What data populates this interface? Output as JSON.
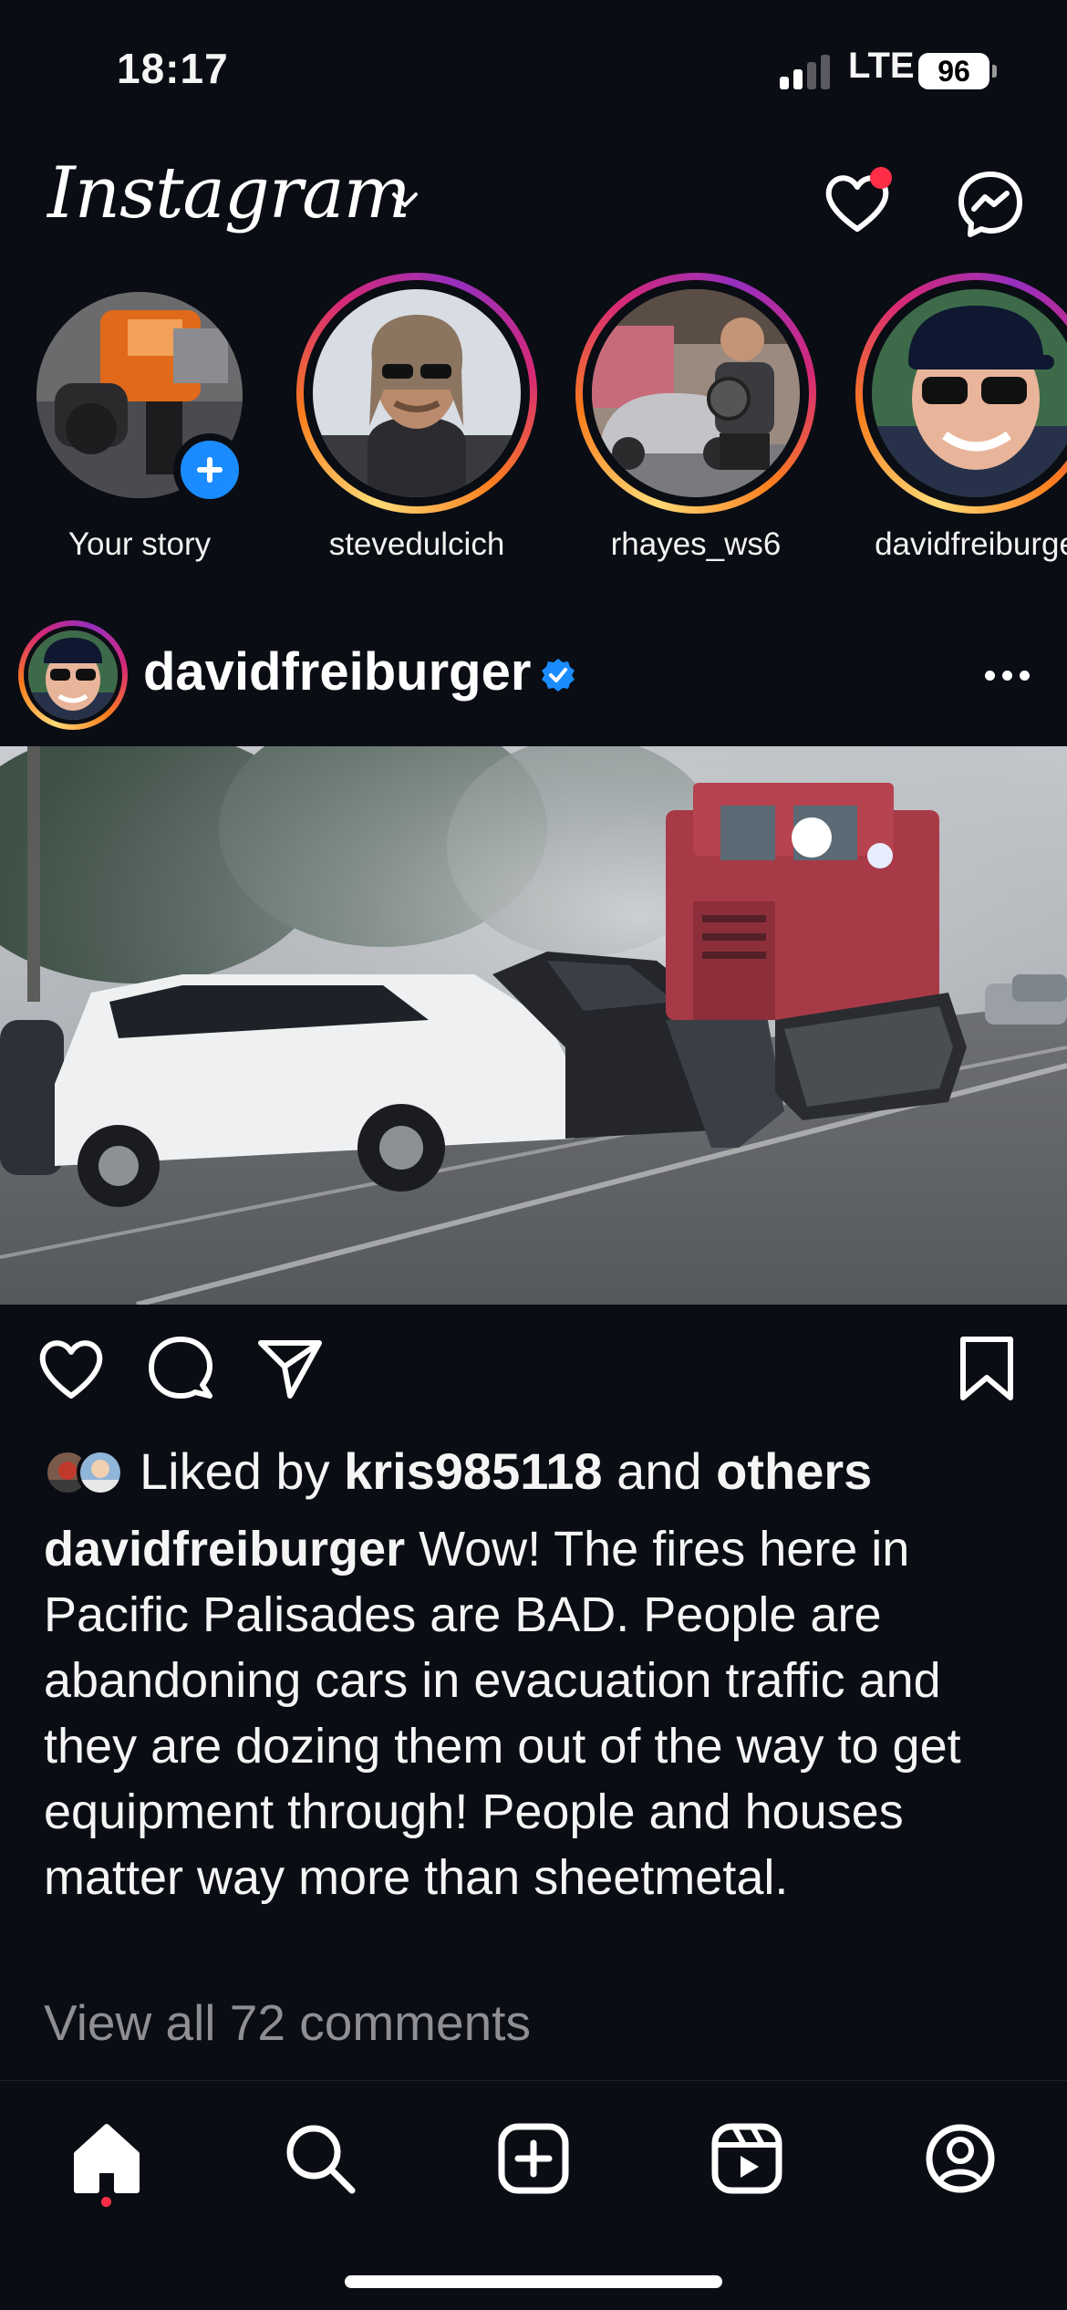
{
  "status_bar": {
    "time": "18:17",
    "network": "LTE",
    "battery": "96"
  },
  "header": {
    "logo": "Instagram",
    "icons": [
      "chevron-down-icon",
      "heart-icon",
      "messenger-icon"
    ],
    "notification_color": "#ff2e47"
  },
  "stories": [
    {
      "label": "Your story"
    },
    {
      "label": "stevedulcich"
    },
    {
      "label": "rhayes_ws6"
    },
    {
      "label": "davidfreiburge"
    }
  ],
  "post": {
    "username": "davidfreiburger",
    "verified_color": "#1a8cff",
    "likes": {
      "prefix": "Liked by ",
      "user": "kris985118",
      "middle": " and ",
      "others": "others"
    },
    "caption_user": "davidfreiburger",
    "caption_text": " Wow! The fires here in Pacific Palisades are BAD. People are abandoning cars in evacuation traffic and they are dozing them out of the way to get equipment through! People and houses matter way more than sheetmetal.",
    "view_comments": "View all 72 comments"
  },
  "tab_bar": {
    "items": [
      "home-icon",
      "search-icon",
      "create-icon",
      "reels-icon",
      "profile-icon"
    ]
  }
}
